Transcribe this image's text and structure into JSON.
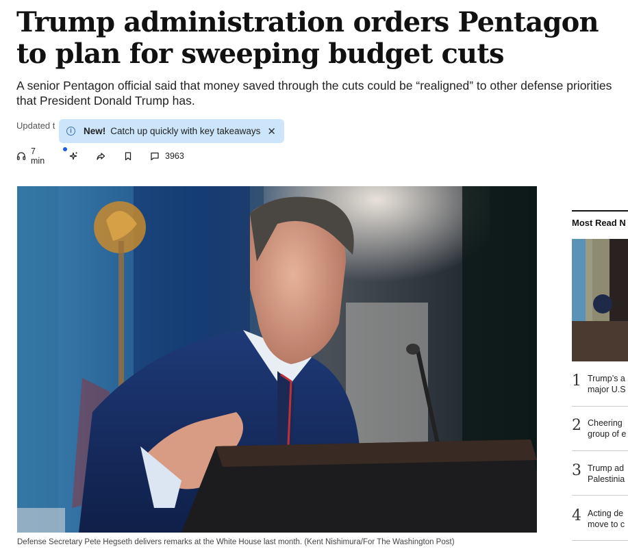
{
  "article": {
    "headline": "Trump administration orders Pentagon to plan for sweeping budget cuts",
    "dek": "A senior Pentagon official said that money saved through the cuts could be “realigned” to other defense priorities that President Donald Trump has.",
    "updated_label": "Updated t"
  },
  "tooltip": {
    "new_label": "New!",
    "text": "Catch up quickly with key takeaways",
    "close_symbol": "✕",
    "bg_color": "#cde5fb"
  },
  "toolbar": {
    "listen_time": "7 min",
    "comment_count": "3963",
    "icons": [
      "headphones-icon",
      "sparkle-icon",
      "share-icon",
      "bookmark-icon",
      "comment-icon"
    ]
  },
  "hero": {
    "caption": "Defense Secretary Pete Hegseth delivers remarks at the White House last month. (Kent Nishimura/For The Washington Post)"
  },
  "most_read": {
    "title": "Most Read N",
    "items": [
      {
        "num": "1",
        "line1": "Trump’s a",
        "line2": "major U.S"
      },
      {
        "num": "2",
        "line1": "Cheering",
        "line2": "group of e"
      },
      {
        "num": "3",
        "line1": "Trump ad",
        "line2": "Palestinia"
      },
      {
        "num": "4",
        "line1": "Acting de",
        "line2": "move to c"
      }
    ]
  }
}
